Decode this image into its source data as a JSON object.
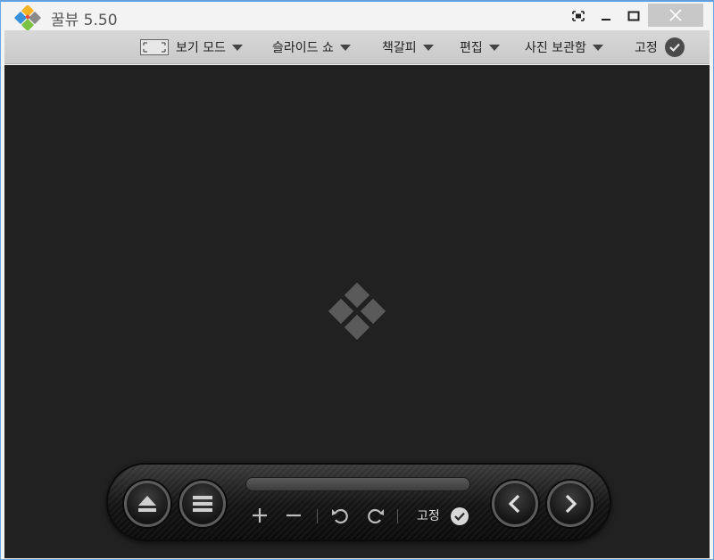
{
  "titlebar": {
    "app_title": "꿀뷰 5.50",
    "logo_colors": [
      "#e84b3c",
      "#f6b325",
      "#7cc242",
      "#3a8fd9"
    ]
  },
  "menu": {
    "items": [
      {
        "label": "보기 모드",
        "icon": "fullscreen-frame-icon",
        "has_caret": true
      },
      {
        "label": "슬라이드 쇼",
        "has_caret": true
      },
      {
        "label": "책갈피",
        "has_caret": true
      },
      {
        "label": "편집",
        "has_caret": true
      },
      {
        "label": "사진 보관함",
        "has_caret": true
      },
      {
        "label": "고정",
        "icon": "check-circle-icon",
        "has_caret": false
      }
    ]
  },
  "viewer": {
    "background": "#212121",
    "placeholder_icon": "diamond-logo-icon"
  },
  "controls": {
    "pin_label": "고정",
    "icons": [
      "eject-icon",
      "list-icon",
      "zoom-in-icon",
      "zoom-out-icon",
      "rotate-left-icon",
      "rotate-right-icon",
      "check-circle-icon",
      "chevron-left-icon",
      "chevron-right-icon"
    ]
  }
}
